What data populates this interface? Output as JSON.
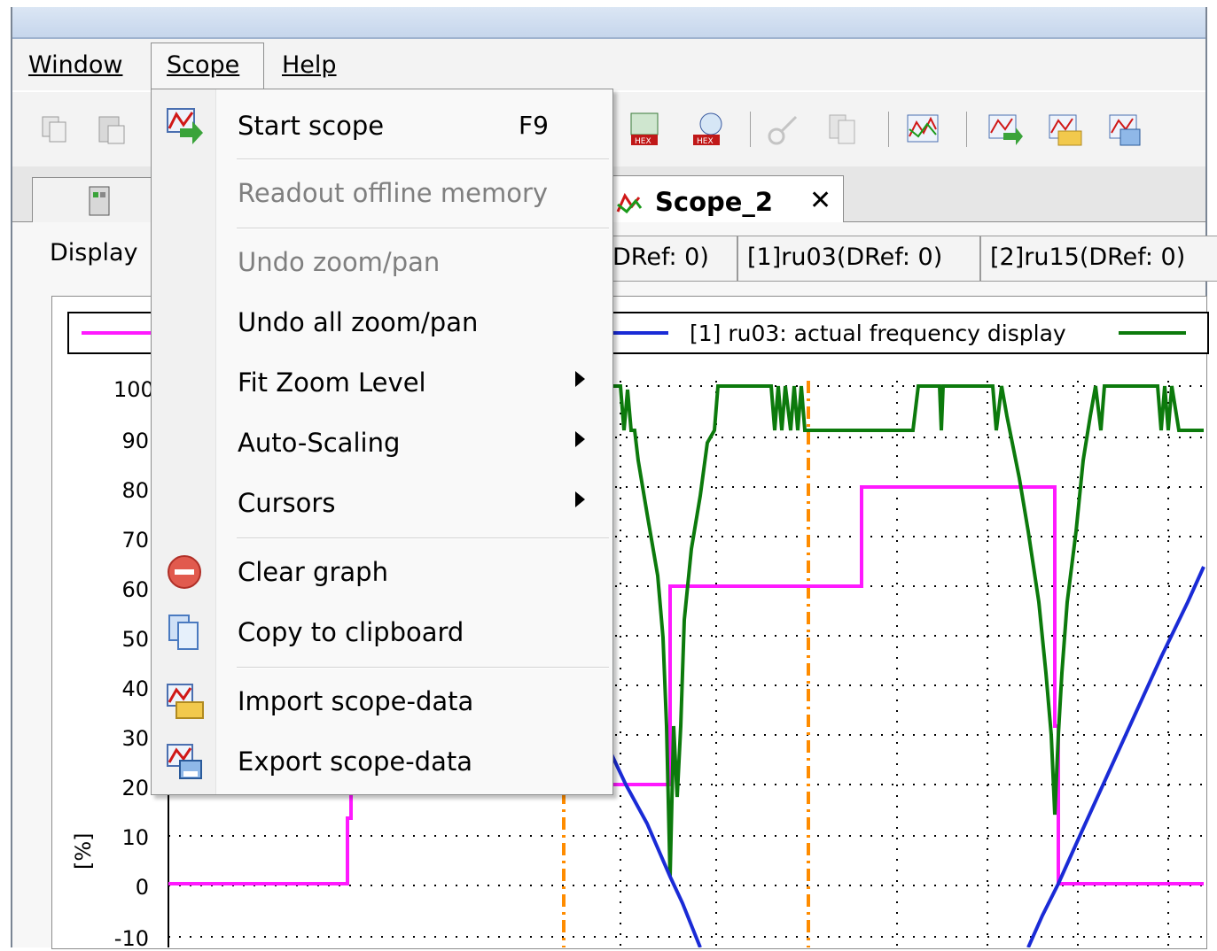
{
  "menubar": {
    "items": [
      {
        "label": "Window"
      },
      {
        "label": "Scope"
      },
      {
        "label": "Help"
      }
    ]
  },
  "tabs": {
    "active_label": "Scope_2",
    "close_glyph": "✕"
  },
  "subtabs": {
    "display_label": "Display",
    "channels": [
      "DRef: 0)",
      "[1]ru03(DRef: 0)",
      "[2]ru15(DRef: 0)"
    ]
  },
  "legend": {
    "text": "[1] ru03: actual frequency display"
  },
  "yaxis": {
    "ticks": [
      "100",
      "90",
      "80",
      "70",
      "60",
      "50",
      "40",
      "30",
      "20",
      "10",
      "0",
      "-10"
    ],
    "label": "[%]"
  },
  "scope_menu": {
    "items": [
      {
        "label": "Start scope",
        "shortcut": "F9",
        "enabled": true,
        "icon": "start-scope-icon"
      },
      {
        "label": "Readout offline memory",
        "enabled": false
      },
      {
        "label": "Undo zoom/pan",
        "enabled": false
      },
      {
        "label": "Undo all zoom/pan",
        "enabled": true
      },
      {
        "label": "Fit Zoom Level",
        "enabled": true,
        "submenu": true
      },
      {
        "label": "Auto-Scaling",
        "enabled": true,
        "submenu": true
      },
      {
        "label": "Cursors",
        "enabled": true,
        "submenu": true
      },
      {
        "label": "Clear graph",
        "enabled": true,
        "icon": "clear-graph-icon"
      },
      {
        "label": "Copy to clipboard",
        "enabled": true,
        "icon": "copy-icon"
      },
      {
        "label": "Import scope-data",
        "enabled": true,
        "icon": "import-icon"
      },
      {
        "label": "Export scope-data",
        "enabled": true,
        "icon": "export-icon"
      }
    ]
  },
  "colors": {
    "magenta_series": "#ff19ff",
    "green_series": "#0c7a0c",
    "blue_series": "#1a2bd6",
    "cursor_orange": "#ff8c00"
  }
}
